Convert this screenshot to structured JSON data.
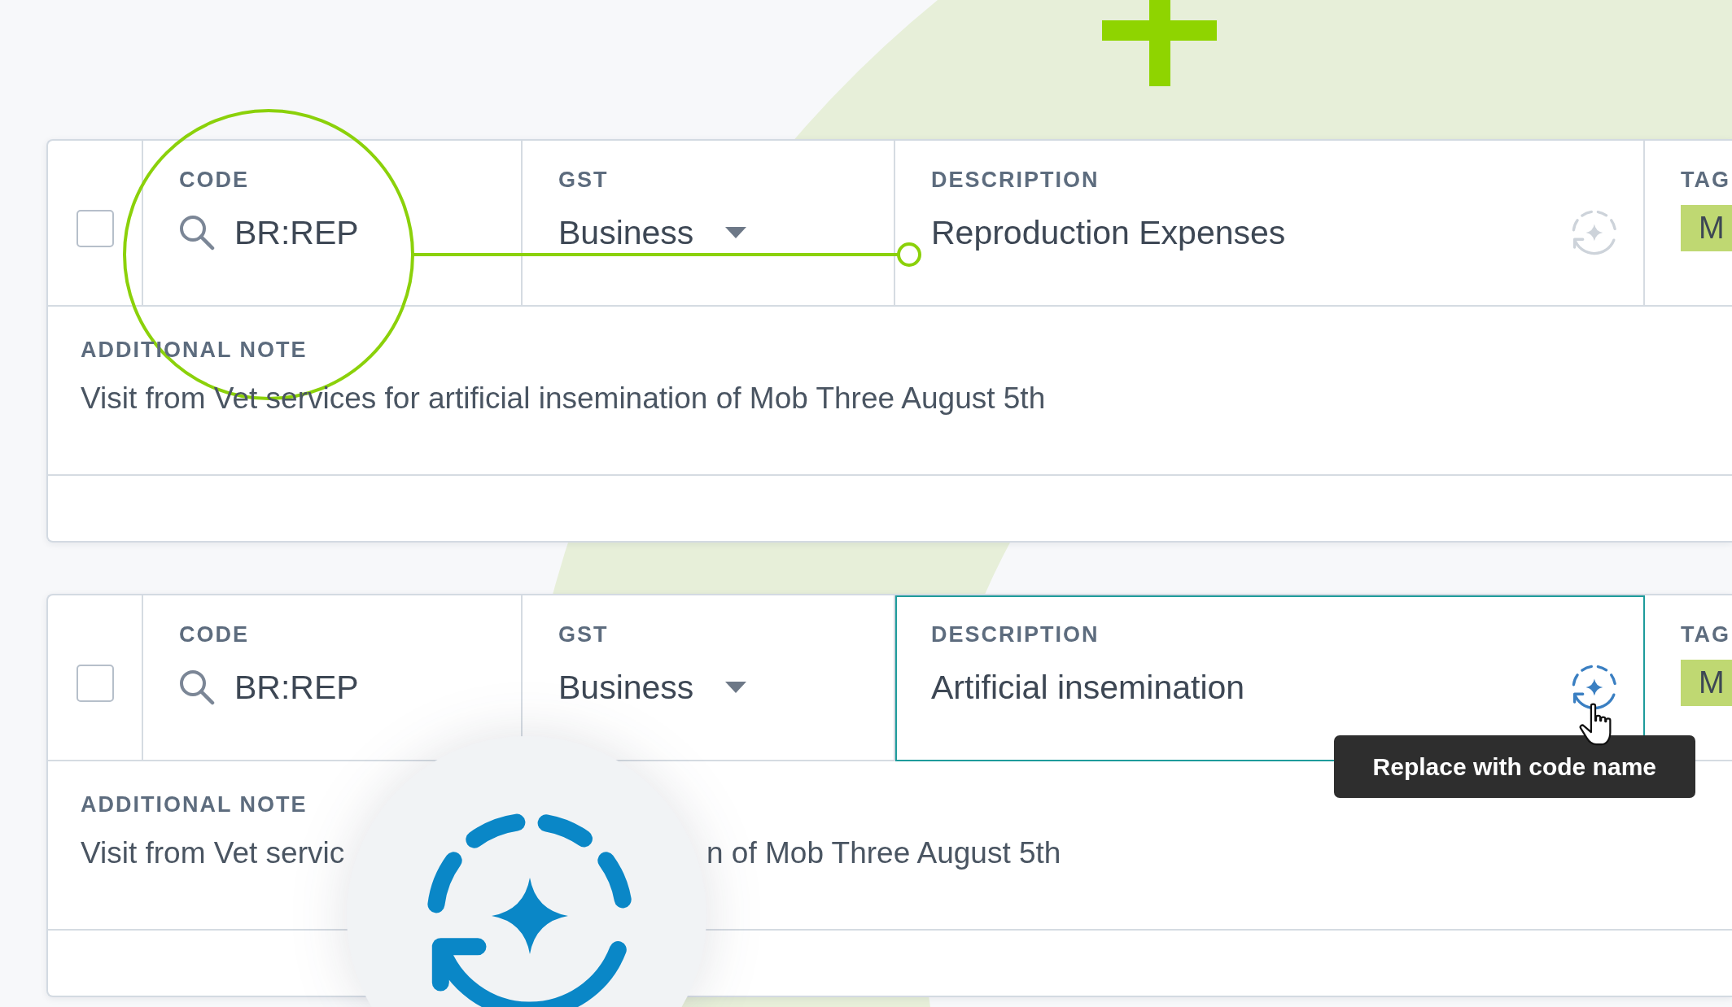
{
  "rows": [
    {
      "checked": false,
      "code": {
        "label": "CODE",
        "value": "BR:REP"
      },
      "gst": {
        "label": "GST",
        "value": "Business"
      },
      "description": {
        "label": "DESCRIPTION",
        "value": "Reproduction Expenses",
        "focused": false,
        "replace_button": {
          "hovered": false
        }
      },
      "tags": {
        "label": "TAG",
        "chip": "M"
      },
      "note": {
        "label": "ADDITIONAL NOTE",
        "text": [
          "Visit from Vet services for artificial insemination of Mob Three August 5th"
        ]
      }
    },
    {
      "checked": false,
      "code": {
        "label": "CODE",
        "value": "BR:REP"
      },
      "gst": {
        "label": "GST",
        "value": "Business"
      },
      "description": {
        "label": "DESCRIPTION",
        "value": "Artificial insemination",
        "focused": true,
        "replace_button": {
          "hovered": true,
          "tooltip": "Replace with code name"
        }
      },
      "tags": {
        "label": "TAG",
        "chip": "M"
      },
      "note": {
        "label": "ADDITIONAL NOTE",
        "text": [
          "Visit from Vet servic",
          "n of Mob Three August 5th"
        ]
      }
    }
  ]
}
